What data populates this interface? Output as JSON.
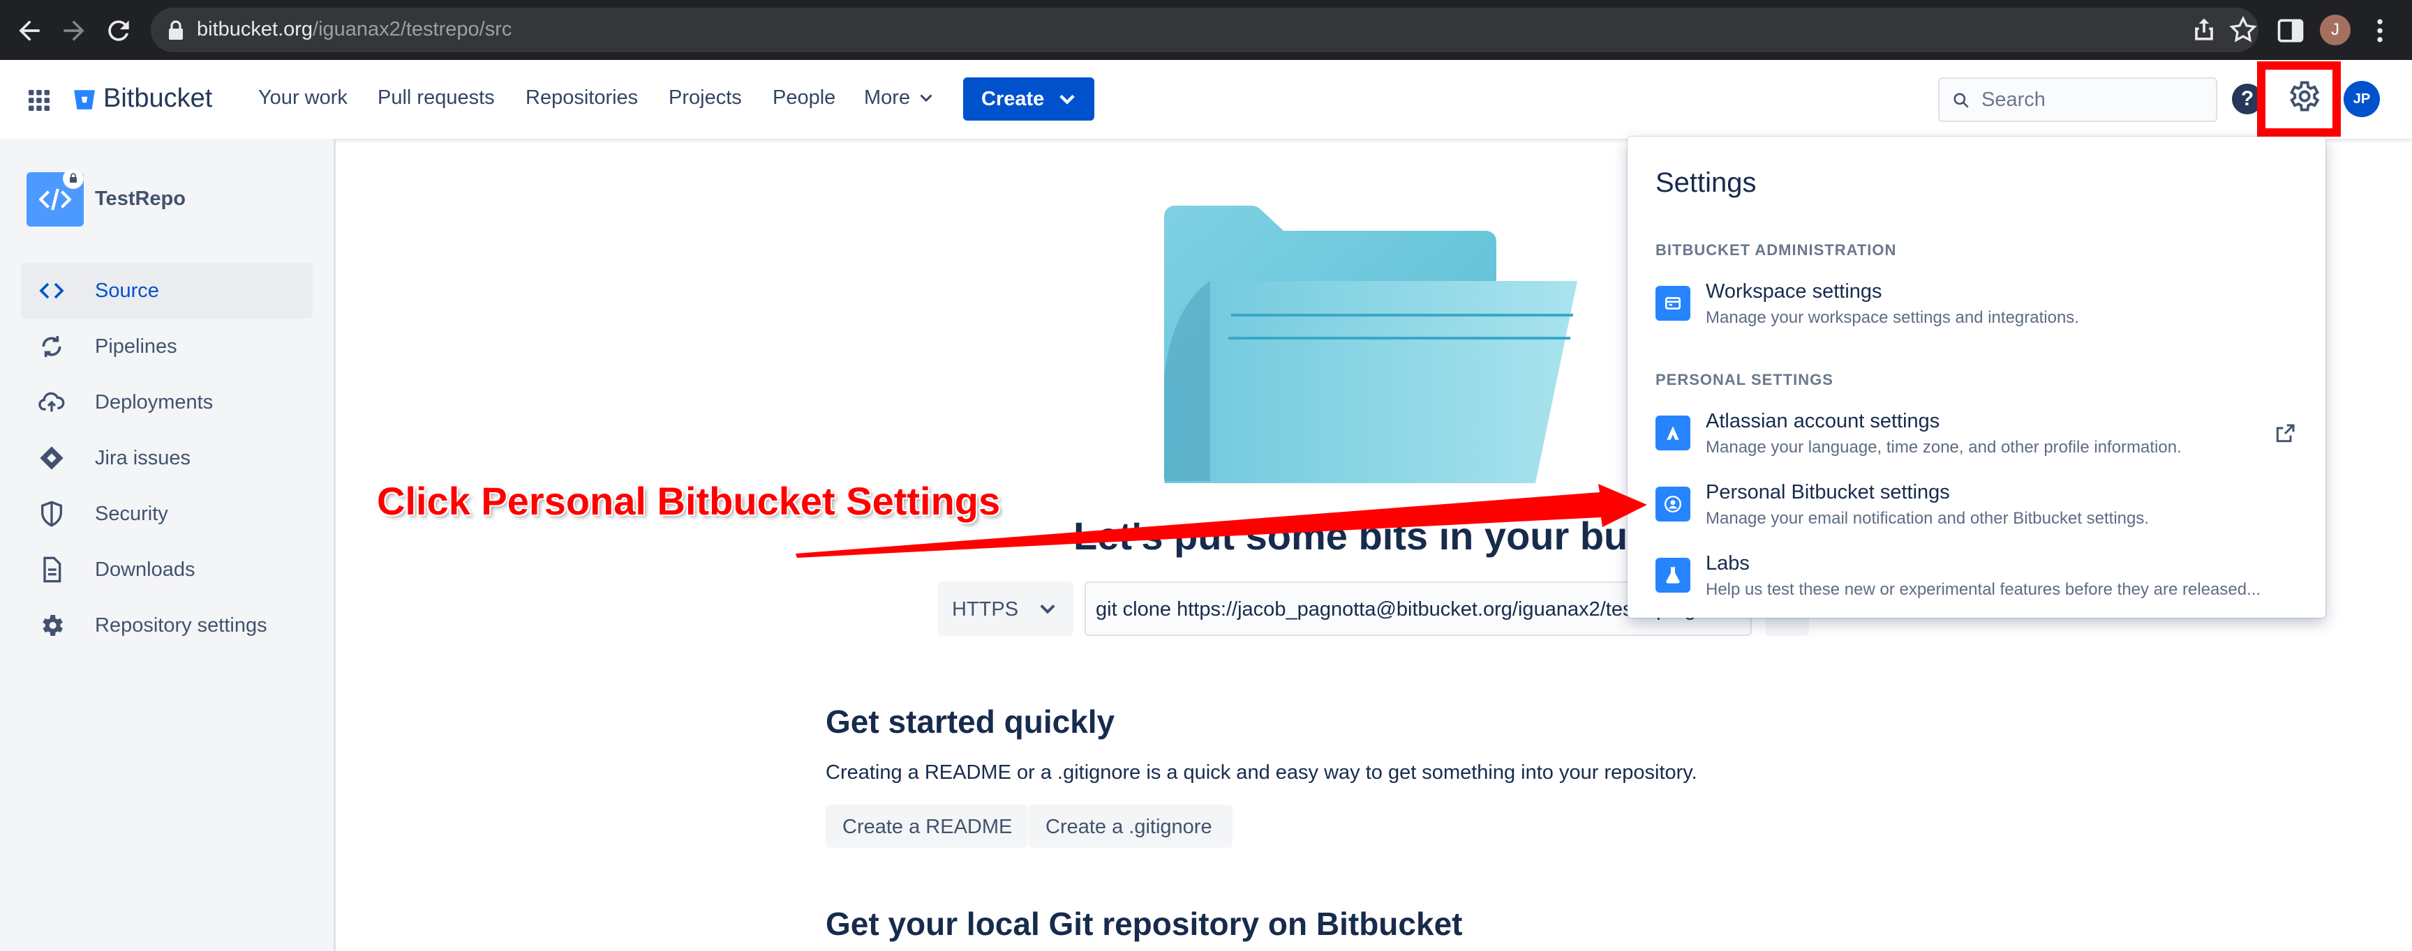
{
  "browser": {
    "url_domain": "bitbucket.org",
    "url_path": "/iguanax2/testrepo/src",
    "profile_initial": "J"
  },
  "topnav": {
    "brand": "Bitbucket",
    "items": [
      "Your work",
      "Pull requests",
      "Repositories",
      "Projects",
      "People",
      "More"
    ],
    "create_label": "Create",
    "search_placeholder": "Search",
    "help_label": "?",
    "user_initials": "JP"
  },
  "sidebar": {
    "repo_name": "TestRepo",
    "items": [
      {
        "label": "Source",
        "icon": "code-icon",
        "active": true
      },
      {
        "label": "Pipelines",
        "icon": "pipelines-icon",
        "active": false
      },
      {
        "label": "Deployments",
        "icon": "cloud-upload-icon",
        "active": false
      },
      {
        "label": "Jira issues",
        "icon": "jira-icon",
        "active": false
      },
      {
        "label": "Security",
        "icon": "shield-icon",
        "active": false
      },
      {
        "label": "Downloads",
        "icon": "document-icon",
        "active": false
      },
      {
        "label": "Repository settings",
        "icon": "gear-icon",
        "active": false
      }
    ]
  },
  "main": {
    "hero_title": "Let's put some bits in your bucket",
    "protocol": "HTTPS",
    "clone_command": "git clone https://jacob_pagnotta@bitbucket.org/iguanax2/testrepo.git",
    "get_started_title": "Get started quickly",
    "get_started_text": "Creating a README or a .gitignore is a quick and easy way to get something into your repository.",
    "create_readme": "Create a README",
    "create_gitignore": "Create a .gitignore",
    "local_repo_title": "Get your local Git repository on Bitbucket"
  },
  "settings_menu": {
    "title": "Settings",
    "section_admin": "BITBUCKET ADMINISTRATION",
    "section_personal": "PERSONAL SETTINGS",
    "items": [
      {
        "name": "Workspace settings",
        "desc": "Manage your workspace settings and integrations.",
        "icon": "workspace-icon"
      },
      {
        "name": "Atlassian account settings",
        "desc": "Manage your language, time zone, and other profile information.",
        "icon": "atlassian-icon"
      },
      {
        "name": "Personal Bitbucket settings",
        "desc": "Manage your email notification and other Bitbucket settings.",
        "icon": "person-icon"
      },
      {
        "name": "Labs",
        "desc": "Help us test these new or experimental features before they are released...",
        "icon": "flask-icon"
      }
    ]
  },
  "annotation": {
    "text": "Click Personal Bitbucket Settings",
    "color": "#ff0000"
  },
  "colors": {
    "brand_blue": "#0052cc",
    "sidebar_bg": "#f4f5f7",
    "browser_bg": "#202124"
  }
}
